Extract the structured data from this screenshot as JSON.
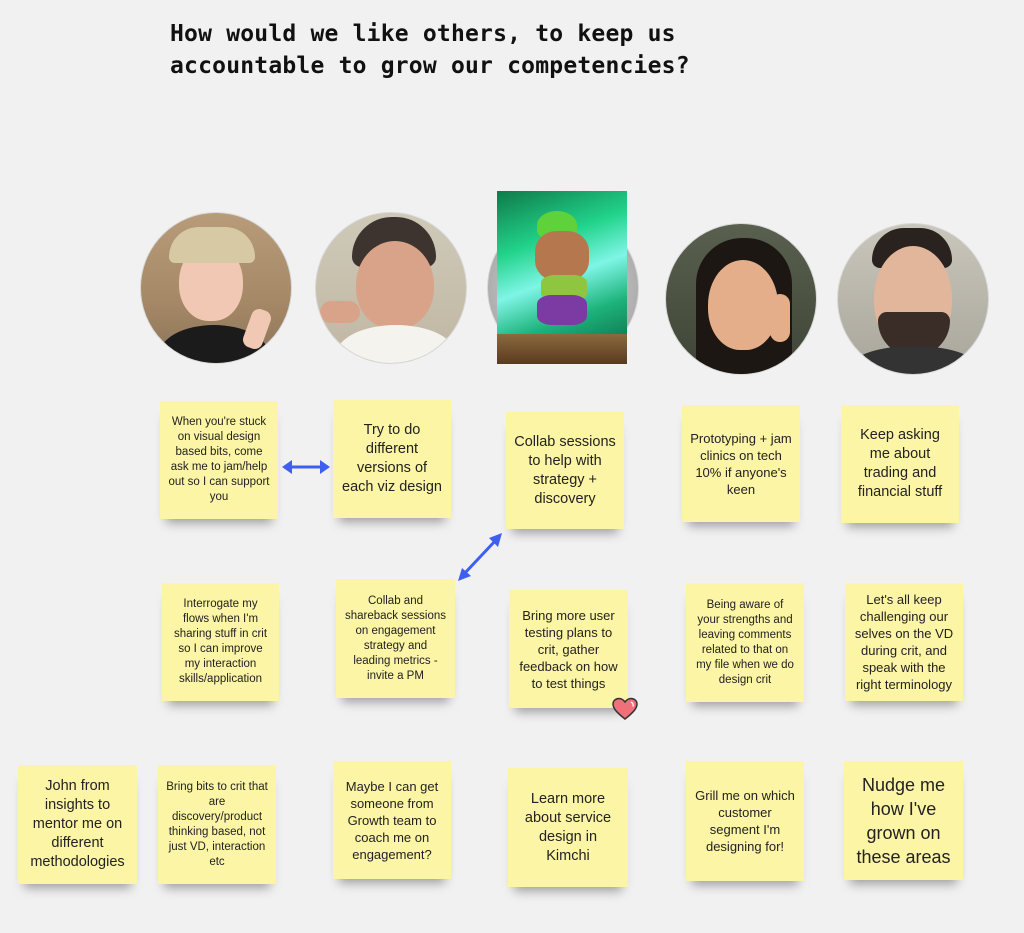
{
  "board": {
    "title": "How would we like others, to keep us accountable to grow our competencies?"
  },
  "colors": {
    "background": "#f1f1f1",
    "sticky": "#fdf5a6",
    "arrow": "#3f5ff0",
    "heart": "#f0707a"
  },
  "avatars": [
    {
      "name": "avatar-1",
      "description": "woman with blonde hair and glasses, peace sign"
    },
    {
      "name": "avatar-2",
      "description": "smiling person with short dark hair"
    },
    {
      "name": "avatar-3",
      "description": "anime character poster over avatar"
    },
    {
      "name": "avatar-4",
      "description": "woman with long dark hair"
    },
    {
      "name": "avatar-5",
      "description": "man with dark beard"
    }
  ],
  "stickies": {
    "row1": [
      "When you're stuck on visual design based bits, come ask me to jam/help out so I can support you",
      "Try to do different versions of each viz design",
      "Collab sessions to help with strategy + discovery",
      "Prototyping + jam clinics on tech 10% if anyone's keen",
      "Keep asking me about trading and financial stuff"
    ],
    "row2": [
      "Interrogate my flows when I'm sharing stuff in crit so I can improve my interaction skills/application",
      "Collab and shareback sessions on engagement strategy and leading metrics - invite a PM",
      "Bring more user testing plans to crit, gather feedback on how to test things",
      "Being aware of your strengths and leaving comments related to that on my file when we do design crit",
      "Let's all keep challenging our selves on the VD during crit, and speak with the right terminology"
    ],
    "row3": [
      "John from insights to mentor me on different methodologies",
      "Bring bits to crit that are discovery/product thinking based, not just VD, interaction etc",
      "Maybe I can get someone from Growth team to coach me on engagement?",
      "Learn more about service design in Kimchi",
      "Grill me on which customer segment I'm designing for!",
      "Nudge me how I've grown on these areas"
    ]
  },
  "reactions": [
    {
      "icon": "heart-icon",
      "on": "Bring more user testing plans to crit, gather feedback on how to test things"
    }
  ]
}
